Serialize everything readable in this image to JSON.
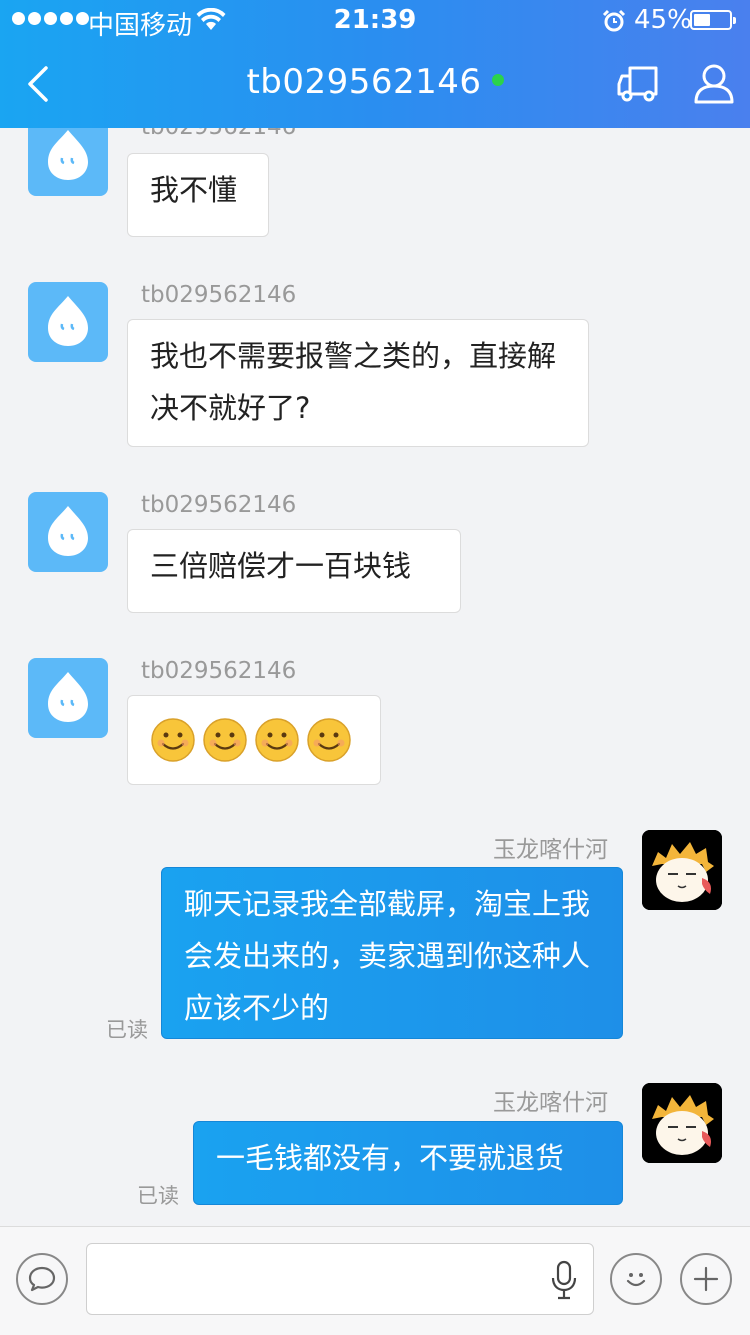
{
  "status_bar": {
    "carrier": "中国移动",
    "time": "21:39",
    "battery_percent": "45%"
  },
  "header": {
    "title": "tb029562146",
    "online_color": "#2bd34b"
  },
  "messages": [
    {
      "sender": "tb029562146",
      "text": "我不懂"
    },
    {
      "sender": "tb029562146",
      "text": "我也不需要报警之类的，直接解决不就好了?"
    },
    {
      "sender": "tb029562146",
      "text": "三倍赔偿才一百块钱"
    },
    {
      "sender": "tb029562146",
      "text": "",
      "emoji": [
        "smiling-face",
        "smiling-face",
        "smiling-face",
        "smiling-face"
      ]
    },
    {
      "sender": "玉龙喀什河",
      "text": "聊天记录我全部截屏，淘宝上我会发出来的，卖家遇到你这种人应该不少的",
      "status": "已读"
    },
    {
      "sender": "玉龙喀什河",
      "text": "一毛钱都没有，不要就退货",
      "status": "已读"
    }
  ],
  "input": {
    "placeholder": ""
  },
  "colors": {
    "header_gradient_start": "#1aa5f2",
    "header_gradient_end": "#4a80ee",
    "outgoing_bubble": "#1e8fe8",
    "bot_avatar": "#5cb9f8"
  }
}
